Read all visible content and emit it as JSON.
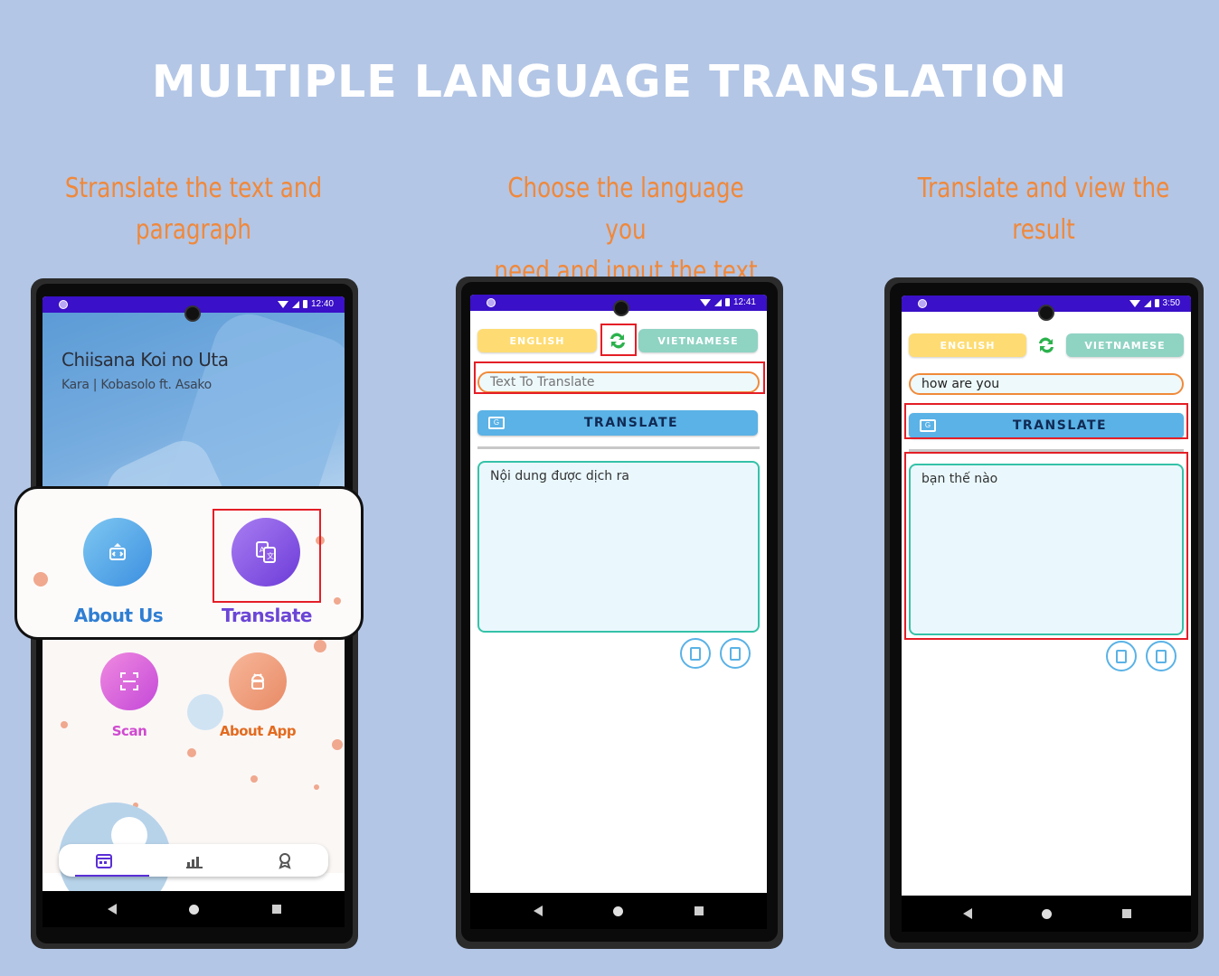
{
  "headline": "MULTIPLE LANGUAGE TRANSLATION",
  "captions": [
    {
      "line1": "Stranslate the text and",
      "line2": "paragraph"
    },
    {
      "line1": "Choose the language you",
      "line2": "need and input the text"
    },
    {
      "line1": "Translate and view the",
      "line2": "result"
    }
  ],
  "phone1": {
    "time": "12:40",
    "song_title": "Chiisana Koi no Uta",
    "song_artist": "Kara | Kobasolo ft. Asako",
    "menu": {
      "about_us": "About Us",
      "translate": "Translate",
      "scan": "Scan",
      "about_app": "About App"
    }
  },
  "phone2": {
    "time": "12:41",
    "source_lang": "ENGLISH",
    "target_lang": "VIETNAMESE",
    "input_value": "",
    "input_placeholder": "Text To Translate",
    "translate_label": "TRANSLATE",
    "output_text": "Nội dung được dịch ra"
  },
  "phone3": {
    "time": "3:50",
    "source_lang": "ENGLISH",
    "target_lang": "VIETNAMESE",
    "input_value": "how are you",
    "translate_label": "TRANSLATE",
    "output_text": "bạn thế nào"
  },
  "colors": {
    "background": "#b3c6e6",
    "caption": "#f0883a",
    "status_bar": "#3a10c8",
    "highlight": "#e41e26",
    "english_button": "#fedc73",
    "vietnamese_button": "#8fd3c3",
    "translate_button": "#5ab2e6"
  }
}
